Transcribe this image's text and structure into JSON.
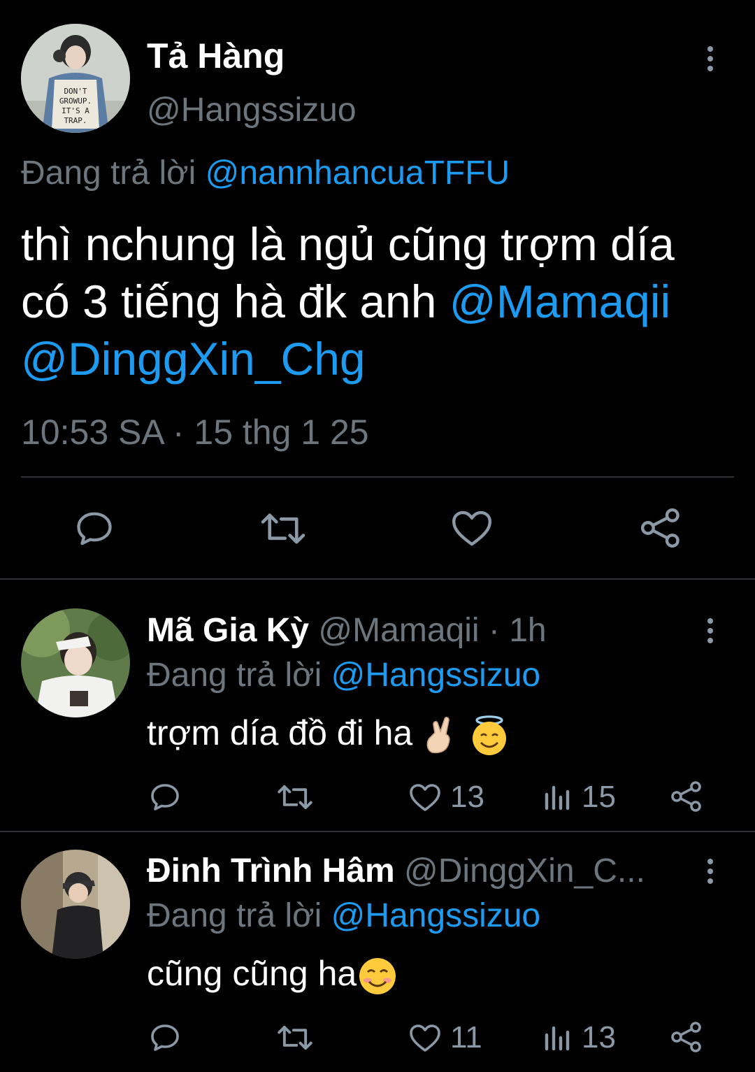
{
  "main_tweet": {
    "author_name": "Tả Hàng",
    "author_handle": "@Hangssizuo",
    "replying_label": "Đang trả lời",
    "replying_to": "@nannhancuaTFFU",
    "text_line1": "thì nchung là ngủ cũng trợm día",
    "text_line2": "có 3 tiếng hà đk anh",
    "mention1": "@Mamaqii",
    "mention2": "@DinggXin_Chg",
    "timestamp": "10:53 SA · 15 thg 1 25",
    "shirt_text": "DON'T GROW UP. IT'S A TRAP."
  },
  "replies": [
    {
      "author_name": "Mã Gia Kỳ",
      "author_handle": "@Mamaqii",
      "time": " · 1h",
      "replying_label": "Đang trả lời",
      "replying_to": "@Hangssizuo",
      "text": "trợm día đồ đi ha",
      "likes": "13",
      "views": "15"
    },
    {
      "author_name": "Đinh Trình Hâm",
      "author_handle": "@DinggXin_C...",
      "replying_label": "Đang trả lời",
      "replying_to": "@Hangssizuo",
      "text": "cũng cũng ha",
      "likes": "11",
      "views": "13"
    }
  ],
  "colors": {
    "background": "#000000",
    "accent": "#1d9bf0",
    "muted": "#6e767d",
    "divider": "#2f3336"
  },
  "icons": [
    "reply-icon",
    "retweet-icon",
    "like-icon",
    "share-icon",
    "views-icon",
    "more-icon"
  ]
}
